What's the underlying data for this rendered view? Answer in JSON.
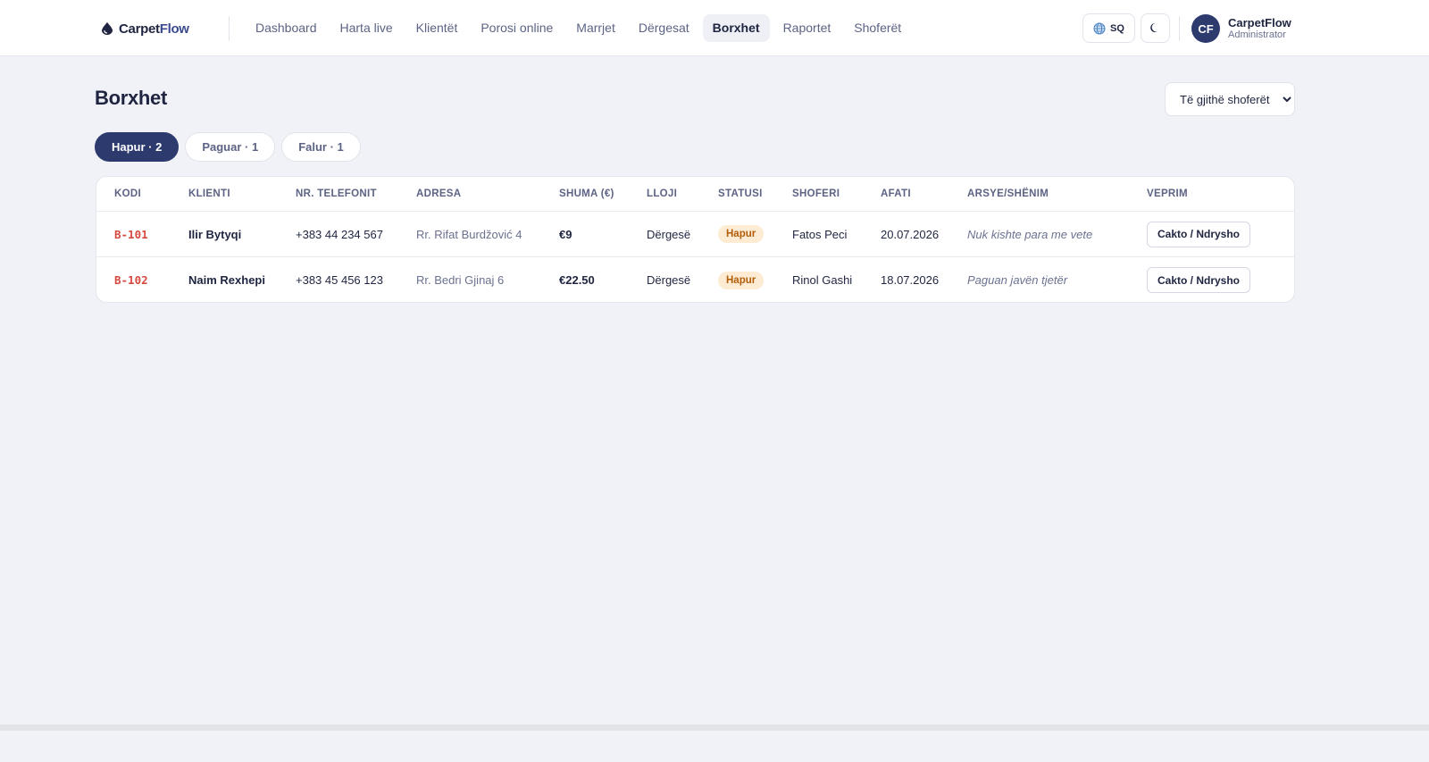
{
  "brand": {
    "name_part1": "Carpet",
    "name_part2": "Flow"
  },
  "nav": {
    "items": [
      {
        "label": "Dashboard",
        "active": false
      },
      {
        "label": "Harta live",
        "active": false
      },
      {
        "label": "Klientët",
        "active": false
      },
      {
        "label": "Porosi online",
        "active": false
      },
      {
        "label": "Marrjet",
        "active": false
      },
      {
        "label": "Dërgesat",
        "active": false
      },
      {
        "label": "Borxhet",
        "active": true
      },
      {
        "label": "Raportet",
        "active": false
      },
      {
        "label": "Shoferët",
        "active": false
      }
    ]
  },
  "header": {
    "language": "SQ",
    "user": {
      "initials": "CF",
      "name": "CarpetFlow",
      "role": "Administrator"
    }
  },
  "page": {
    "title": "Borxhet",
    "driver_filter": {
      "selected": "Të gjithë shoferët"
    }
  },
  "tabs": [
    {
      "label": "Hapur · 2",
      "active": true
    },
    {
      "label": "Paguar · 1",
      "active": false
    },
    {
      "label": "Falur · 1",
      "active": false
    }
  ],
  "table": {
    "headers": [
      "KODI",
      "KLIENTI",
      "NR. TELEFONIT",
      "ADRESA",
      "SHUMA (€)",
      "LLOJI",
      "STATUSI",
      "SHOFERI",
      "AFATI",
      "ARSYE/SHËNIM",
      "VEPRIM"
    ],
    "rows": [
      {
        "kodi": "B-101",
        "klienti": "Ilir Bytyqi",
        "telefoni": "+383 44 234 567",
        "adresa": "Rr. Rifat Burdžović 4",
        "shuma": "€9",
        "lloji": "Dërgesë",
        "statusi": "Hapur",
        "shoferi": "Fatos Peci",
        "afati": "20.07.2026",
        "shenim": "Nuk kishte para me vete",
        "veprim": "Cakto / Ndrysho"
      },
      {
        "kodi": "B-102",
        "klienti": "Naim Rexhepi",
        "telefoni": "+383 45 456 123",
        "adresa": "Rr. Bedri Gjinaj 6",
        "shuma": "€22.50",
        "lloji": "Dërgesë",
        "statusi": "Hapur",
        "shoferi": "Rinol Gashi",
        "afati": "18.07.2026",
        "shenim": "Paguan javën tjetër",
        "veprim": "Cakto / Ndrysho"
      }
    ]
  },
  "colors": {
    "primary": "#2d3a6e",
    "code_red": "#d6493f",
    "badge_bg": "#fdebd3",
    "badge_text": "#b25e09",
    "background": "#f1f2f7"
  }
}
